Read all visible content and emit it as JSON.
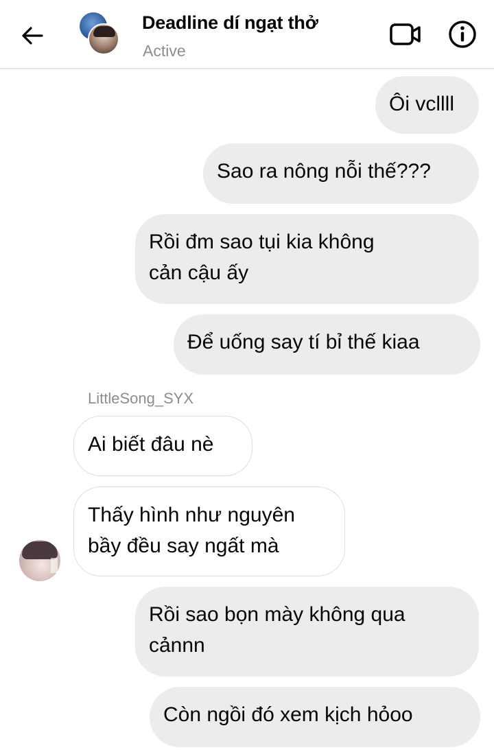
{
  "header": {
    "title": "Deadline dí ngạt thở",
    "status": "Active",
    "icons": {
      "back": "arrow-left-icon",
      "video": "video-camera-icon",
      "info": "info-icon"
    }
  },
  "messages": [
    {
      "direction": "outgoing",
      "text": "Ôi vcllll"
    },
    {
      "direction": "outgoing",
      "text": "Sao ra nông nỗi thế???"
    },
    {
      "direction": "outgoing",
      "lines": [
        "Rồi đm sao tụi kia không",
        "cản cậu ấy"
      ]
    },
    {
      "direction": "outgoing",
      "text": "Để uống say tí bỉ thế kiaa"
    },
    {
      "direction": "incoming",
      "sender": "LittleSong_SYX",
      "text": "Ai biết đâu nè"
    },
    {
      "direction": "incoming",
      "lines": [
        "Thấy hình như nguyên",
        "bầy đều say ngất mà"
      ]
    },
    {
      "direction": "outgoing",
      "lines": [
        "Rồi sao bọn mày không qua",
        "cảnnn"
      ]
    },
    {
      "direction": "outgoing",
      "text": "Còn ngồi đó xem kịch hỏoo"
    }
  ],
  "colors": {
    "outgoing_bubble": "#ececec",
    "incoming_border": "#dadde1",
    "muted_text": "#8a8d91",
    "text": "#050505"
  }
}
